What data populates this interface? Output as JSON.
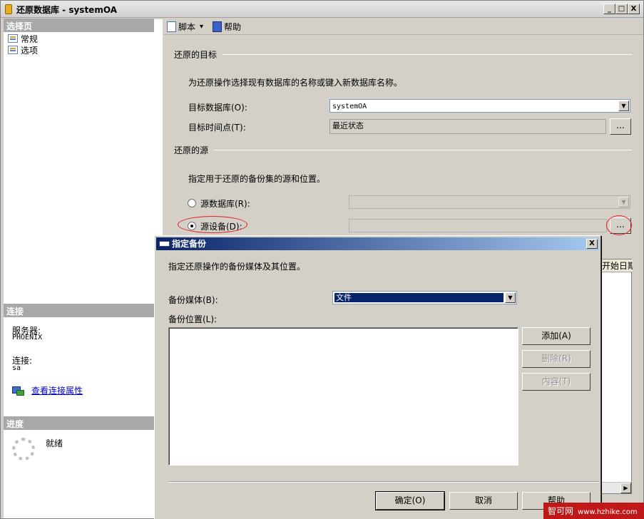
{
  "window": {
    "title": "还原数据库 - systemOA",
    "controls": [
      "_",
      "□",
      "X"
    ]
  },
  "left": {
    "select_page_header": "选择页",
    "pages": [
      {
        "label": "常规"
      },
      {
        "label": "选项"
      }
    ],
    "connection_header": "连接",
    "server_label": "服务器:",
    "server_value": "PHOENIX",
    "connection_label": "连接:",
    "connection_value": "sa",
    "view_props_link": "查看连接属性",
    "progress_header": "进度",
    "progress_status": "就绪"
  },
  "toolbar": {
    "script_label": "脚本",
    "script_arrow": "▾",
    "help_label": "帮助"
  },
  "target": {
    "group_title": "还原的目标",
    "description": "为还原操作选择现有数据库的名称或键入新数据库名称。",
    "db_label": "目标数据库(O):",
    "db_value": "systemOA",
    "time_label": "目标时间点(T):",
    "time_value": "最近状态",
    "time_button": "..."
  },
  "source": {
    "group_title": "还原的源",
    "description": "指定用于还原的备份集的源和位置。",
    "source_db_label": "源数据库(R):",
    "source_device_label": "源设备(D):",
    "device_button": "...",
    "selected": "source_device"
  },
  "backup_grid": {
    "column_partial": "开始日期"
  },
  "dialog": {
    "title": "指定备份",
    "close": "X",
    "description": "指定还原操作的备份媒体及其位置。",
    "media_label": "备份媒体(B):",
    "media_value": "文件",
    "location_label": "备份位置(L):",
    "buttons": {
      "add": "添加(A)",
      "remove": "删除(R)",
      "contents": "内容(T)"
    },
    "footer": {
      "ok": "确定(O)",
      "cancel": "取消",
      "help": "帮助"
    }
  },
  "watermark": {
    "brand": "智可网",
    "url": "www.hzhike.com"
  },
  "colors": {
    "dialog_title_start": "#0a246a",
    "dialog_title_end": "#a6caf0",
    "annotation": "#e02020",
    "watermark": "#c01818"
  }
}
